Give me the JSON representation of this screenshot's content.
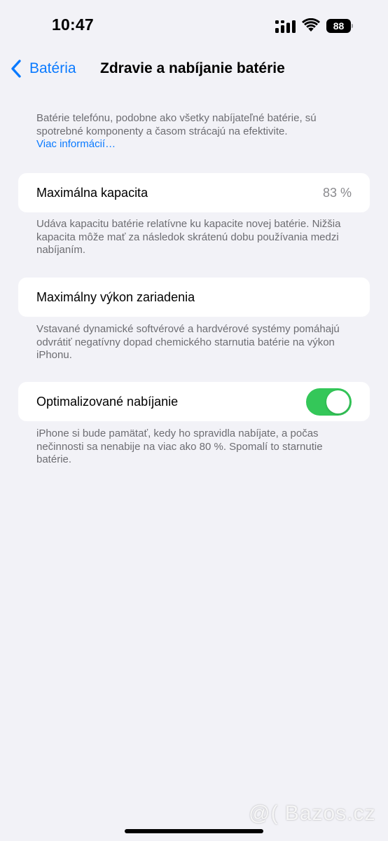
{
  "status_bar": {
    "time": "10:47",
    "battery_level": "88",
    "icons": [
      "cellular-signal-icon",
      "wifi-icon",
      "battery-icon"
    ]
  },
  "nav": {
    "back_label": "Batéria",
    "title": "Zdravie a nabíjanie batérie"
  },
  "intro": {
    "text": "Batérie telefónu, podobne ako všetky nabíjateľné batérie, sú spotrebné komponenty a časom strácajú na efektivite.",
    "link": "Viac informácií…"
  },
  "max_capacity": {
    "label": "Maximálna kapacita",
    "value": "83 %",
    "footer": "Udáva kapacitu batérie relatívne ku kapacite novej batérie. Nižšia kapacita môže mať za následok skrátenú dobu používania medzi nabíjaním."
  },
  "peak_performance": {
    "label": "Maximálny výkon zariadenia",
    "footer": "Vstavané dynamické softvérové a hardvérové systémy pomáhajú odvrátiť negatívny dopad chemického starnutia batérie na výkon iPhonu."
  },
  "optimized_charging": {
    "label": "Optimalizované nabíjanie",
    "enabled": true,
    "footer": "iPhone si bude pamätať, kedy ho spravidla nabíjate, a počas nečinnosti sa nenabije na viac ako 80 %. Spomalí to starnutie batérie."
  },
  "colors": {
    "accent": "#0a7aff",
    "toggle_on": "#34c759",
    "background": "#f2f2f7"
  },
  "watermark": "@( Bazos.cz"
}
